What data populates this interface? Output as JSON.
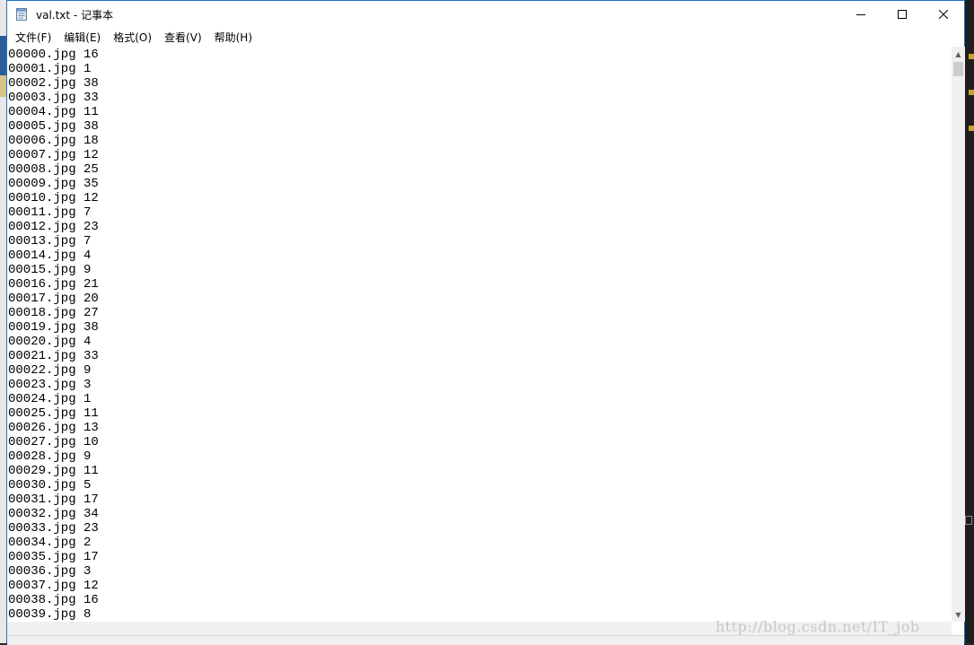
{
  "window": {
    "title": "val.txt - 记事本",
    "app_icon": "notepad-icon",
    "minimize_icon": "minimize-icon",
    "maximize_icon": "maximize-icon",
    "close_icon": "close-icon"
  },
  "menu": {
    "items": [
      {
        "label": "文件(F)"
      },
      {
        "label": "编辑(E)"
      },
      {
        "label": "格式(O)"
      },
      {
        "label": "查看(V)"
      },
      {
        "label": "帮助(H)"
      }
    ]
  },
  "document": {
    "lines": [
      "00000.jpg 16",
      "00001.jpg 1",
      "00002.jpg 38",
      "00003.jpg 33",
      "00004.jpg 11",
      "00005.jpg 38",
      "00006.jpg 18",
      "00007.jpg 12",
      "00008.jpg 25",
      "00009.jpg 35",
      "00010.jpg 12",
      "00011.jpg 7",
      "00012.jpg 23",
      "00013.jpg 7",
      "00014.jpg 4",
      "00015.jpg 9",
      "00016.jpg 21",
      "00017.jpg 20",
      "00018.jpg 27",
      "00019.jpg 38",
      "00020.jpg 4",
      "00021.jpg 33",
      "00022.jpg 9",
      "00023.jpg 3",
      "00024.jpg 1",
      "00025.jpg 11",
      "00026.jpg 13",
      "00027.jpg 10",
      "00028.jpg 9",
      "00029.jpg 11",
      "00030.jpg 5",
      "00031.jpg 17",
      "00032.jpg 34",
      "00033.jpg 23",
      "00034.jpg 2",
      "00035.jpg 17",
      "00036.jpg 3",
      "00037.jpg 12",
      "00038.jpg 16",
      "00039.jpg 8"
    ]
  },
  "watermark": "http://blog.csdn.net/IT_job",
  "colors": {
    "window_border": "#1e6fc9",
    "scrollbar_bg": "#f0f0f0",
    "watermark": "#c7c7c7"
  }
}
